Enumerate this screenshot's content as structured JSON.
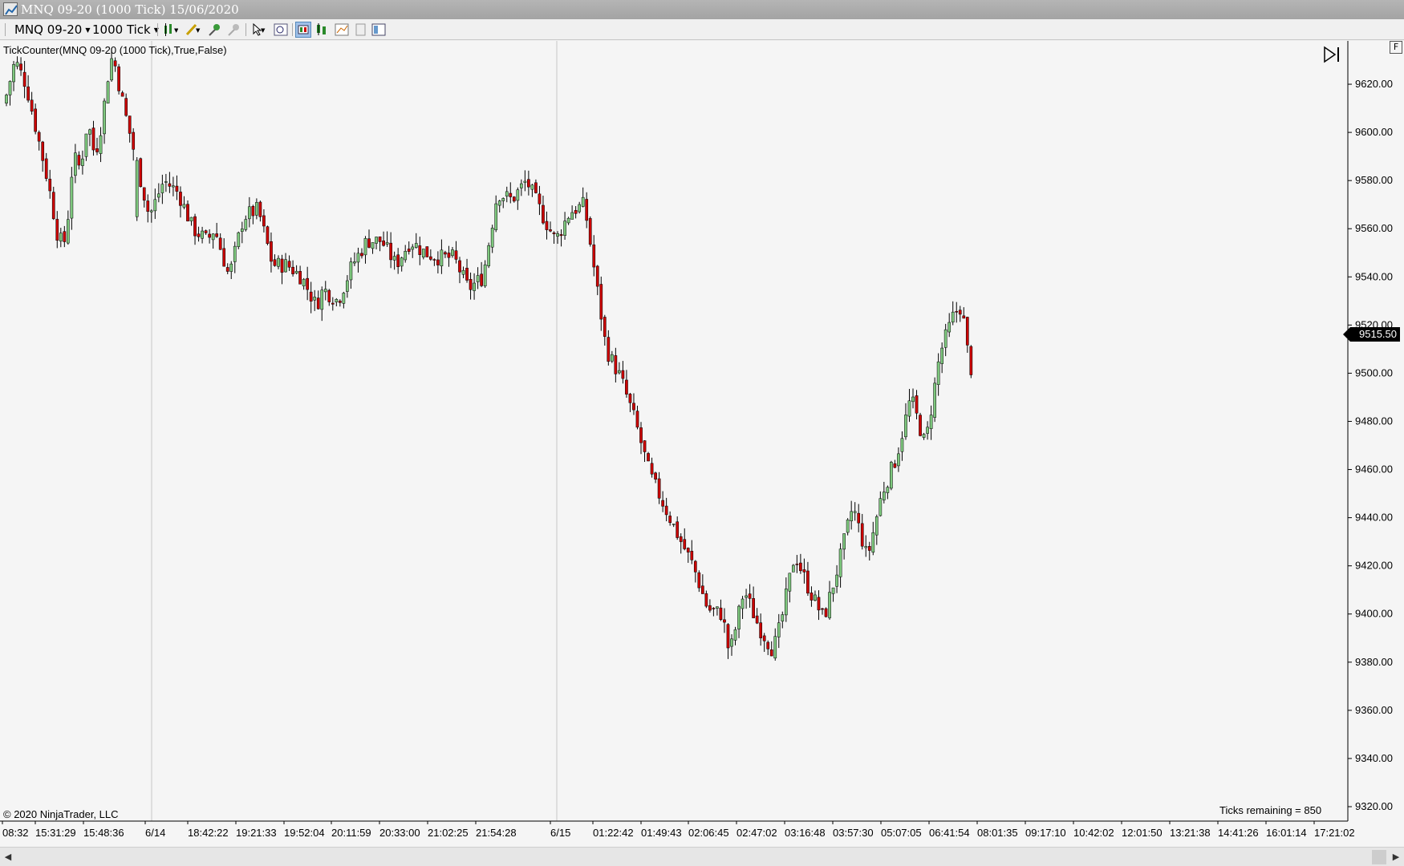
{
  "window": {
    "title": "MNQ 09-20 (1000 Tick)  15/06/2020"
  },
  "toolbar": {
    "instrument": "MNQ 09-20",
    "interval": "1000 Tick"
  },
  "chart_labels": {
    "indicator": "TickCounter(MNQ  09-20  (1000 Tick),True,False)",
    "copyright": "© 2020 NinjaTrader, LLC",
    "ticks_remaining": "Ticks remaining = 850",
    "last_price": "9515.50",
    "panel_button": "F"
  },
  "colors": {
    "up_candle": "#7ec87e",
    "down_candle": "#cc0000",
    "wick": "#000000",
    "background": "#f5f5f5"
  },
  "chart_data": {
    "type": "candlestick",
    "title": "",
    "ylim": [
      9316,
      9635
    ],
    "y_ticks": [
      9620,
      9600,
      9580,
      9560,
      9540,
      9520,
      9500,
      9480,
      9460,
      9440,
      9420,
      9400,
      9380,
      9360,
      9340,
      9320
    ],
    "y_tick_labels": [
      "9620.00",
      "9600.00",
      "9580.00",
      "9560.00",
      "9540.00",
      "9520.00",
      "9500.00",
      "9480.00",
      "9460.00",
      "9440.00",
      "9420.00",
      "9400.00",
      "9380.00",
      "9360.00",
      "9340.00",
      "9320.00"
    ],
    "x_tick_labels": [
      "08:32",
      "15:31:29",
      "15:48:36",
      "6/14",
      "18:42:22",
      "19:21:33",
      "19:52:04",
      "20:11:59",
      "20:33:00",
      "21:02:25",
      "21:54:28",
      "6/15",
      "01:22:42",
      "01:49:43",
      "02:06:45",
      "02:47:02",
      "03:16:48",
      "03:57:30",
      "05:07:05",
      "06:41:54",
      "08:01:35",
      "09:17:10",
      "10:42:02",
      "12:01:50",
      "13:21:38",
      "14:41:26",
      "16:01:14",
      "17:21:02"
    ],
    "session_breaks": [
      "6/14",
      "6/15"
    ],
    "bars_drawn": 266,
    "path_points": [
      [
        0,
        9612
      ],
      [
        3,
        9630
      ],
      [
        6,
        9620
      ],
      [
        9,
        9600
      ],
      [
        12,
        9580
      ],
      [
        15,
        9555
      ],
      [
        17,
        9555
      ],
      [
        19,
        9590
      ],
      [
        21,
        9585
      ],
      [
        23,
        9605
      ],
      [
        25,
        9590
      ],
      [
        27,
        9605
      ],
      [
        29,
        9628
      ],
      [
        30,
        9632
      ],
      [
        33,
        9610
      ],
      [
        40,
        9565
      ],
      [
        44,
        9580
      ],
      [
        48,
        9575
      ],
      [
        52,
        9560
      ],
      [
        56,
        9555
      ],
      [
        58,
        9560
      ],
      [
        62,
        9540
      ],
      [
        66,
        9565
      ],
      [
        70,
        9568
      ],
      [
        74,
        9545
      ],
      [
        78,
        9545
      ],
      [
        82,
        9540
      ],
      [
        86,
        9528
      ],
      [
        88,
        9535
      ],
      [
        92,
        9530
      ],
      [
        96,
        9545
      ],
      [
        100,
        9555
      ],
      [
        104,
        9555
      ],
      [
        108,
        9545
      ],
      [
        112,
        9555
      ],
      [
        116,
        9550
      ],
      [
        120,
        9548
      ],
      [
        124,
        9548
      ],
      [
        128,
        9535
      ],
      [
        132,
        9540
      ],
      [
        136,
        9575
      ],
      [
        140,
        9572
      ],
      [
        144,
        9580
      ],
      [
        148,
        9567
      ],
      [
        152,
        9555
      ],
      [
        156,
        9567
      ],
      [
        160,
        9570
      ],
      [
        162,
        9550
      ],
      [
        166,
        9510
      ],
      [
        170,
        9498
      ],
      [
        174,
        9480
      ],
      [
        178,
        9458
      ],
      [
        182,
        9445
      ],
      [
        186,
        9432
      ],
      [
        190,
        9420
      ],
      [
        194,
        9402
      ],
      [
        198,
        9400
      ],
      [
        200,
        9383
      ],
      [
        204,
        9410
      ],
      [
        208,
        9395
      ],
      [
        212,
        9385
      ],
      [
        214,
        9395
      ],
      [
        218,
        9425
      ],
      [
        222,
        9410
      ],
      [
        226,
        9398
      ],
      [
        230,
        9420
      ],
      [
        234,
        9445
      ],
      [
        238,
        9423
      ],
      [
        242,
        9450
      ],
      [
        246,
        9465
      ],
      [
        250,
        9490
      ],
      [
        254,
        9470
      ],
      [
        258,
        9508
      ],
      [
        262,
        9525
      ],
      [
        264,
        9528
      ],
      [
        266,
        9505
      ],
      [
        270,
        9485
      ],
      [
        274,
        9478
      ],
      [
        278,
        9500
      ],
      [
        280,
        9528
      ],
      [
        284,
        9505
      ],
      [
        288,
        9495
      ],
      [
        292,
        9520
      ],
      [
        296,
        9505
      ],
      [
        300,
        9515
      ]
    ]
  }
}
